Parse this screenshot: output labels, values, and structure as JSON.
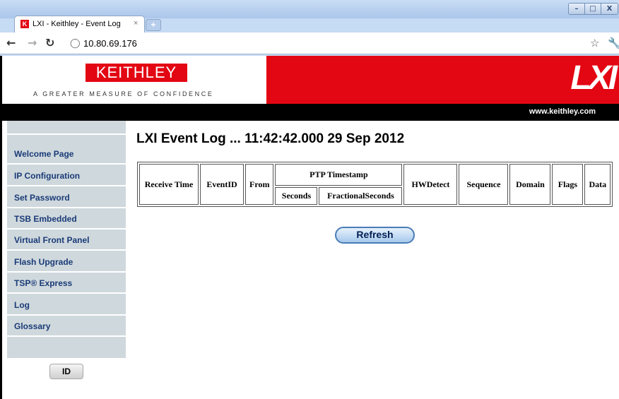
{
  "browser": {
    "tab_title": "LXI - Keithley - Event Log",
    "tab_close": "×",
    "new_tab": "+",
    "url": "10.80.69.176",
    "window_buttons": [
      "–",
      "□",
      "X"
    ]
  },
  "header": {
    "logo": "KEITHLEY",
    "tagline": "A GREATER MEASURE OF CONFIDENCE",
    "lxi_logo": "LXI",
    "website": "www.keithley.com",
    "brand_color": "#e30613"
  },
  "sidebar": {
    "items": [
      {
        "label": "Welcome Page"
      },
      {
        "label": "IP Configuration"
      },
      {
        "label": "Set Password"
      },
      {
        "label": "TSB Embedded"
      },
      {
        "label": "Virtual Front Panel"
      },
      {
        "label": "Flash Upgrade"
      },
      {
        "label": "TSP® Express"
      },
      {
        "label": "Log"
      },
      {
        "label": "Glossary"
      }
    ],
    "id_button": "ID"
  },
  "main": {
    "title": "LXI Event Log ... 11:42:42.000 29 Sep 2012",
    "table": {
      "headers": {
        "receive_time": "Receive Time",
        "event_id": "EventID",
        "from": "From",
        "ptp_timestamp": "PTP Timestamp",
        "seconds": "Seconds",
        "fractional_seconds": "FractionalSeconds",
        "hw_detect": "HWDetect",
        "sequence": "Sequence",
        "domain": "Domain",
        "flags": "Flags",
        "data": "Data"
      }
    },
    "refresh_label": "Refresh"
  }
}
